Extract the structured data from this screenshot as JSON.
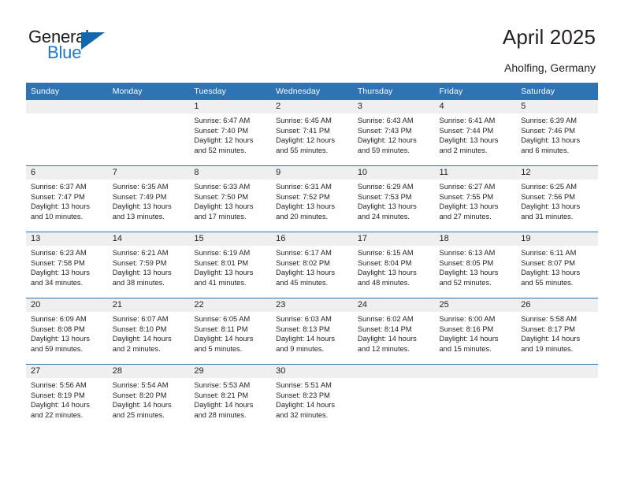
{
  "brand": {
    "name_part1": "General",
    "name_part2": "Blue",
    "triangle_color": "#1267ad",
    "blue_text_color": "#1f77c2"
  },
  "header": {
    "title": "April 2025",
    "subtitle": "Aholfing, Germany",
    "accent_color": "#2e74b5",
    "daynum_background": "#efefef"
  },
  "calendar": {
    "weekday_headers": [
      "Sunday",
      "Monday",
      "Tuesday",
      "Wednesday",
      "Thursday",
      "Friday",
      "Saturday"
    ],
    "labels": {
      "sunrise": "Sunrise:",
      "sunset": "Sunset:",
      "daylight": "Daylight:"
    },
    "weeks": [
      [
        {
          "day": "",
          "empty": true
        },
        {
          "day": "",
          "empty": true
        },
        {
          "day": "1",
          "sunrise": "Sunrise: 6:47 AM",
          "sunset": "Sunset: 7:40 PM",
          "daylight1": "Daylight: 12 hours",
          "daylight2": "and 52 minutes."
        },
        {
          "day": "2",
          "sunrise": "Sunrise: 6:45 AM",
          "sunset": "Sunset: 7:41 PM",
          "daylight1": "Daylight: 12 hours",
          "daylight2": "and 55 minutes."
        },
        {
          "day": "3",
          "sunrise": "Sunrise: 6:43 AM",
          "sunset": "Sunset: 7:43 PM",
          "daylight1": "Daylight: 12 hours",
          "daylight2": "and 59 minutes."
        },
        {
          "day": "4",
          "sunrise": "Sunrise: 6:41 AM",
          "sunset": "Sunset: 7:44 PM",
          "daylight1": "Daylight: 13 hours",
          "daylight2": "and 2 minutes."
        },
        {
          "day": "5",
          "sunrise": "Sunrise: 6:39 AM",
          "sunset": "Sunset: 7:46 PM",
          "daylight1": "Daylight: 13 hours",
          "daylight2": "and 6 minutes."
        }
      ],
      [
        {
          "day": "6",
          "sunrise": "Sunrise: 6:37 AM",
          "sunset": "Sunset: 7:47 PM",
          "daylight1": "Daylight: 13 hours",
          "daylight2": "and 10 minutes."
        },
        {
          "day": "7",
          "sunrise": "Sunrise: 6:35 AM",
          "sunset": "Sunset: 7:49 PM",
          "daylight1": "Daylight: 13 hours",
          "daylight2": "and 13 minutes."
        },
        {
          "day": "8",
          "sunrise": "Sunrise: 6:33 AM",
          "sunset": "Sunset: 7:50 PM",
          "daylight1": "Daylight: 13 hours",
          "daylight2": "and 17 minutes."
        },
        {
          "day": "9",
          "sunrise": "Sunrise: 6:31 AM",
          "sunset": "Sunset: 7:52 PM",
          "daylight1": "Daylight: 13 hours",
          "daylight2": "and 20 minutes."
        },
        {
          "day": "10",
          "sunrise": "Sunrise: 6:29 AM",
          "sunset": "Sunset: 7:53 PM",
          "daylight1": "Daylight: 13 hours",
          "daylight2": "and 24 minutes."
        },
        {
          "day": "11",
          "sunrise": "Sunrise: 6:27 AM",
          "sunset": "Sunset: 7:55 PM",
          "daylight1": "Daylight: 13 hours",
          "daylight2": "and 27 minutes."
        },
        {
          "day": "12",
          "sunrise": "Sunrise: 6:25 AM",
          "sunset": "Sunset: 7:56 PM",
          "daylight1": "Daylight: 13 hours",
          "daylight2": "and 31 minutes."
        }
      ],
      [
        {
          "day": "13",
          "sunrise": "Sunrise: 6:23 AM",
          "sunset": "Sunset: 7:58 PM",
          "daylight1": "Daylight: 13 hours",
          "daylight2": "and 34 minutes."
        },
        {
          "day": "14",
          "sunrise": "Sunrise: 6:21 AM",
          "sunset": "Sunset: 7:59 PM",
          "daylight1": "Daylight: 13 hours",
          "daylight2": "and 38 minutes."
        },
        {
          "day": "15",
          "sunrise": "Sunrise: 6:19 AM",
          "sunset": "Sunset: 8:01 PM",
          "daylight1": "Daylight: 13 hours",
          "daylight2": "and 41 minutes."
        },
        {
          "day": "16",
          "sunrise": "Sunrise: 6:17 AM",
          "sunset": "Sunset: 8:02 PM",
          "daylight1": "Daylight: 13 hours",
          "daylight2": "and 45 minutes."
        },
        {
          "day": "17",
          "sunrise": "Sunrise: 6:15 AM",
          "sunset": "Sunset: 8:04 PM",
          "daylight1": "Daylight: 13 hours",
          "daylight2": "and 48 minutes."
        },
        {
          "day": "18",
          "sunrise": "Sunrise: 6:13 AM",
          "sunset": "Sunset: 8:05 PM",
          "daylight1": "Daylight: 13 hours",
          "daylight2": "and 52 minutes."
        },
        {
          "day": "19",
          "sunrise": "Sunrise: 6:11 AM",
          "sunset": "Sunset: 8:07 PM",
          "daylight1": "Daylight: 13 hours",
          "daylight2": "and 55 minutes."
        }
      ],
      [
        {
          "day": "20",
          "sunrise": "Sunrise: 6:09 AM",
          "sunset": "Sunset: 8:08 PM",
          "daylight1": "Daylight: 13 hours",
          "daylight2": "and 59 minutes."
        },
        {
          "day": "21",
          "sunrise": "Sunrise: 6:07 AM",
          "sunset": "Sunset: 8:10 PM",
          "daylight1": "Daylight: 14 hours",
          "daylight2": "and 2 minutes."
        },
        {
          "day": "22",
          "sunrise": "Sunrise: 6:05 AM",
          "sunset": "Sunset: 8:11 PM",
          "daylight1": "Daylight: 14 hours",
          "daylight2": "and 5 minutes."
        },
        {
          "day": "23",
          "sunrise": "Sunrise: 6:03 AM",
          "sunset": "Sunset: 8:13 PM",
          "daylight1": "Daylight: 14 hours",
          "daylight2": "and 9 minutes."
        },
        {
          "day": "24",
          "sunrise": "Sunrise: 6:02 AM",
          "sunset": "Sunset: 8:14 PM",
          "daylight1": "Daylight: 14 hours",
          "daylight2": "and 12 minutes."
        },
        {
          "day": "25",
          "sunrise": "Sunrise: 6:00 AM",
          "sunset": "Sunset: 8:16 PM",
          "daylight1": "Daylight: 14 hours",
          "daylight2": "and 15 minutes."
        },
        {
          "day": "26",
          "sunrise": "Sunrise: 5:58 AM",
          "sunset": "Sunset: 8:17 PM",
          "daylight1": "Daylight: 14 hours",
          "daylight2": "and 19 minutes."
        }
      ],
      [
        {
          "day": "27",
          "sunrise": "Sunrise: 5:56 AM",
          "sunset": "Sunset: 8:19 PM",
          "daylight1": "Daylight: 14 hours",
          "daylight2": "and 22 minutes."
        },
        {
          "day": "28",
          "sunrise": "Sunrise: 5:54 AM",
          "sunset": "Sunset: 8:20 PM",
          "daylight1": "Daylight: 14 hours",
          "daylight2": "and 25 minutes."
        },
        {
          "day": "29",
          "sunrise": "Sunrise: 5:53 AM",
          "sunset": "Sunset: 8:21 PM",
          "daylight1": "Daylight: 14 hours",
          "daylight2": "and 28 minutes."
        },
        {
          "day": "30",
          "sunrise": "Sunrise: 5:51 AM",
          "sunset": "Sunset: 8:23 PM",
          "daylight1": "Daylight: 14 hours",
          "daylight2": "and 32 minutes."
        },
        {
          "day": "",
          "empty": true
        },
        {
          "day": "",
          "empty": true
        },
        {
          "day": "",
          "empty": true
        }
      ]
    ]
  }
}
